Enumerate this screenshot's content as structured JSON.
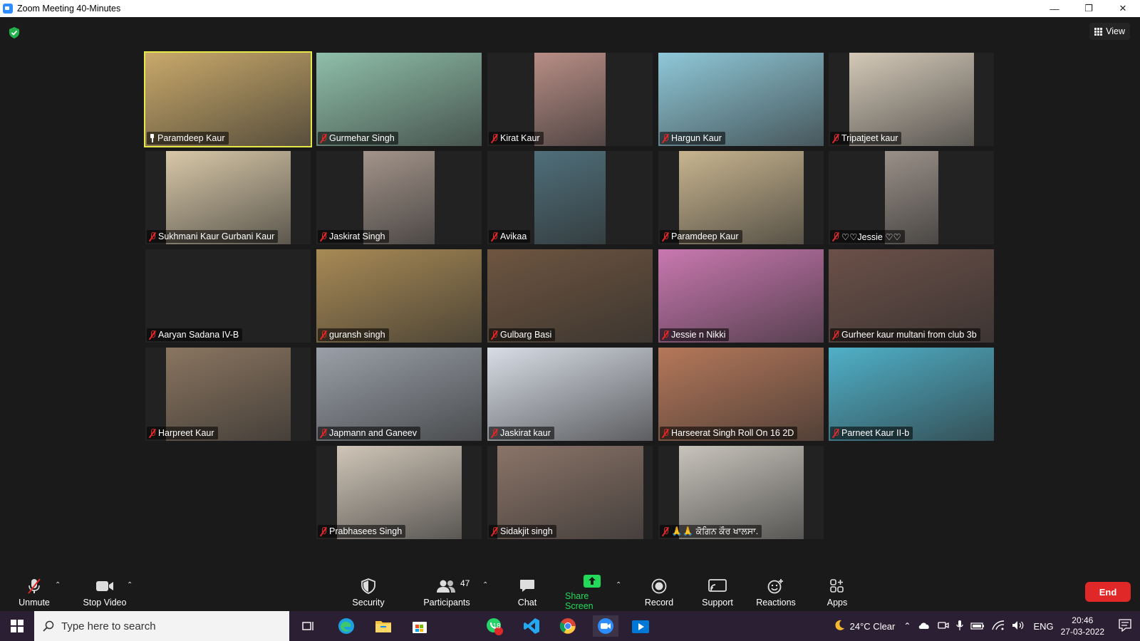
{
  "window": {
    "title": "Zoom Meeting 40-Minutes",
    "minimize": "—",
    "restore": "❐",
    "close": "✕"
  },
  "view_button": {
    "label": "View"
  },
  "participants": [
    {
      "name": "Paramdeep Kaur",
      "pinned": true,
      "active": true,
      "bg": "#c9a96a"
    },
    {
      "name": "Gurmehar Singh",
      "bg": "#8fbfaa"
    },
    {
      "name": "Kirat Kaur",
      "bg": "#b88e86"
    },
    {
      "name": "Hargun Kaur",
      "bg": "#8fc8d8"
    },
    {
      "name": "Tripatjeet kaur",
      "bg": "#d4c9b8"
    },
    {
      "name": "Sukhmani Kaur Gurbani Kaur",
      "bg": "#d8c8a8"
    },
    {
      "name": "Jaskirat Singh",
      "bg": "#a3948a"
    },
    {
      "name": "Avikaa",
      "bg": "#4f6f7a"
    },
    {
      "name": "Paramdeep Kaur",
      "bg": "#c8b58f"
    },
    {
      "name": "♡♡Jessie ♡♡",
      "bg": "#9a9088"
    },
    {
      "name": "Aaryan Sadana IV-B",
      "bg": "#222222"
    },
    {
      "name": "guransh singh",
      "bg": "#a88a55"
    },
    {
      "name": "Gulbarg Basi",
      "bg": "#6e5540"
    },
    {
      "name": "Jessie n Nikki",
      "bg": "#c978b0"
    },
    {
      "name": "Gurheer kaur multani from club 3b",
      "bg": "#6b5048"
    },
    {
      "name": "Harpreet Kaur",
      "bg": "#8a7560"
    },
    {
      "name": "Japmann and Ganeev",
      "bg": "#9aa0a8"
    },
    {
      "name": "Jaskirat kaur",
      "bg": "#d8dde6"
    },
    {
      "name": "Harseerat Singh Roll On 16 2D",
      "bg": "#b5785a"
    },
    {
      "name": "Parneet Kaur II-b",
      "bg": "#4fb0c8"
    },
    {
      "name": "Prabhasees Singh",
      "bg": "#d0c6b8"
    },
    {
      "name": "Sidakjit singh",
      "bg": "#8a7468"
    },
    {
      "name": "🙏🙏 ਕੋਗਿਨ ਕੌਰ ਖਾਲਸਾ.",
      "bg": "#c8c4bc"
    }
  ],
  "toolbar": {
    "unmute": "Unmute",
    "stop_video": "Stop Video",
    "security": "Security",
    "participants": "Participants",
    "participants_count": "47",
    "chat": "Chat",
    "share_screen": "Share Screen",
    "record": "Record",
    "support": "Support",
    "reactions": "Reactions",
    "apps": "Apps",
    "end": "End"
  },
  "taskbar": {
    "search_placeholder": "Type here to search",
    "whatsapp_badge": "18",
    "weather": "24°C  Clear",
    "language": "ENG",
    "time": "20:46",
    "date": "27-03-2022"
  },
  "colors": {
    "accent_green": "#23d959",
    "end_red": "#e02828",
    "active_speaker": "#e6e84a",
    "zoom_blue": "#2d8cff"
  }
}
